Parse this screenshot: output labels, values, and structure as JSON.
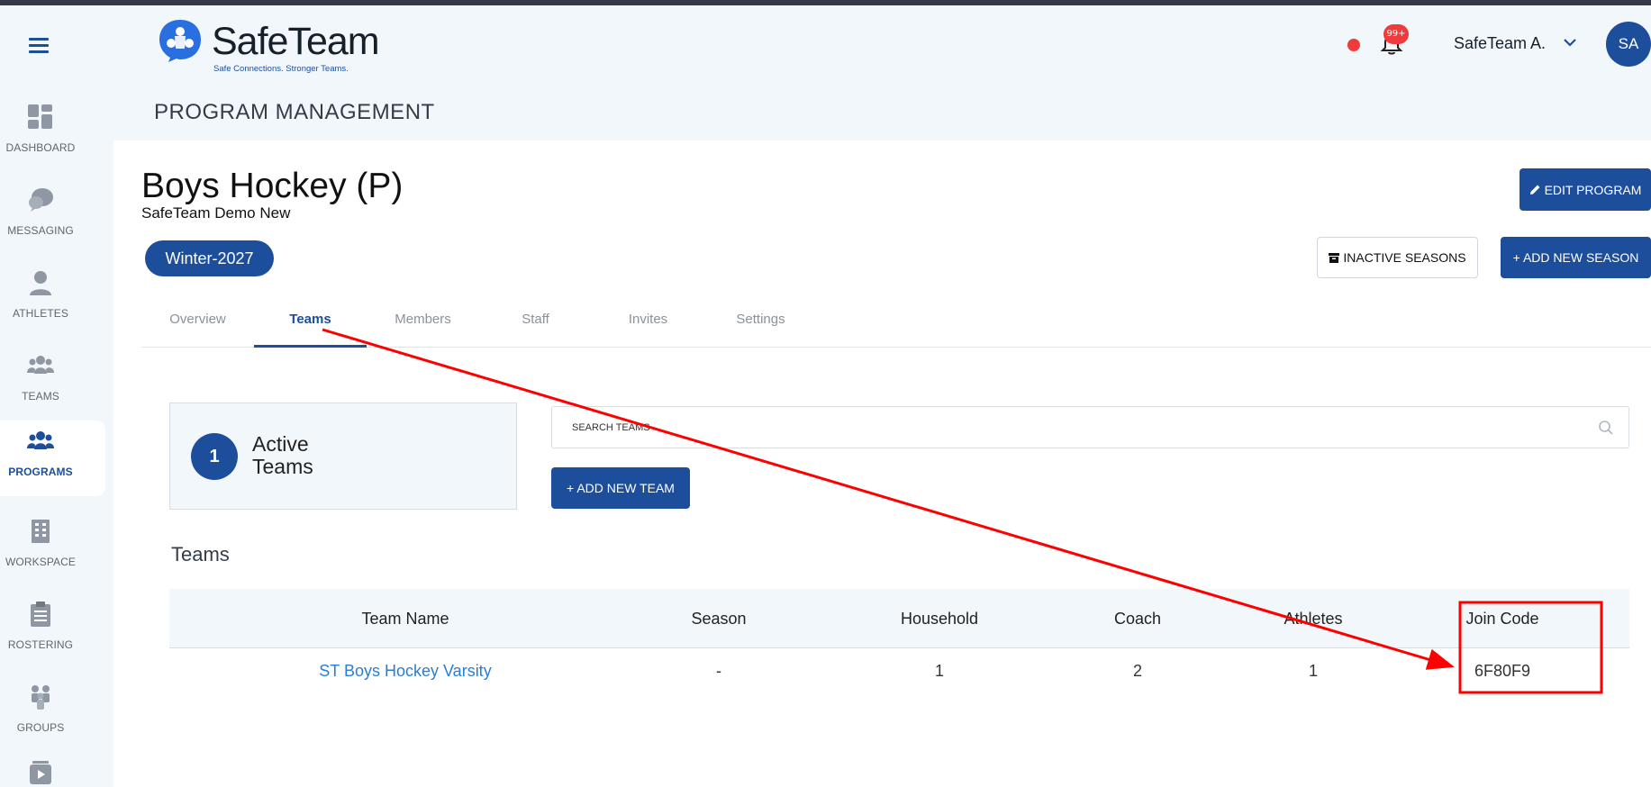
{
  "app": {
    "brand": "SafeTeam",
    "tagline": "Safe Connections. Stronger Teams.",
    "section_title": "PROGRAM MANAGEMENT"
  },
  "colors": {
    "primary": "#1d4e9b",
    "link": "#2a7dd6",
    "alert": "#ef3b3b",
    "annotation": "#ff0000"
  },
  "sidebar": {
    "menu_icon": "hamburger-icon",
    "items": [
      {
        "label": "DASHBOARD",
        "icon": "dashboard-icon",
        "active": false
      },
      {
        "label": "MESSAGING",
        "icon": "chat-bubbles-icon",
        "active": false
      },
      {
        "label": "ATHLETES",
        "icon": "person-icon",
        "active": false
      },
      {
        "label": "TEAMS",
        "icon": "group-icon",
        "active": false
      },
      {
        "label": "PROGRAMS",
        "icon": "group-icon",
        "active": true
      },
      {
        "label": "WORKSPACE",
        "icon": "building-icon",
        "active": false
      },
      {
        "label": "ROSTERING",
        "icon": "clipboard-icon",
        "active": false
      },
      {
        "label": "GROUPS",
        "icon": "people-icon",
        "active": false
      },
      {
        "label": "",
        "icon": "video-icon",
        "active": false
      }
    ]
  },
  "header": {
    "notification_badge": "99+",
    "user_name": "SafeTeam A.",
    "avatar_initials": "SA"
  },
  "program": {
    "title": "Boys Hockey (P)",
    "organization": "SafeTeam Demo New",
    "season": "Winter-2027",
    "edit_button": "EDIT PROGRAM",
    "inactive_seasons_button": "INACTIVE SEASONS",
    "add_season_button": "+ ADD NEW SEASON"
  },
  "tabs": [
    {
      "label": "Overview",
      "active": false
    },
    {
      "label": "Teams",
      "active": true
    },
    {
      "label": "Members",
      "active": false
    },
    {
      "label": "Staff",
      "active": false
    },
    {
      "label": "Invites",
      "active": false
    },
    {
      "label": "Settings",
      "active": false
    }
  ],
  "teams_panel": {
    "active_count": "1",
    "active_label": "Active Teams",
    "search_placeholder": "SEARCH TEAMS",
    "search_value": "",
    "add_team_button": "+ ADD NEW TEAM",
    "heading": "Teams"
  },
  "table": {
    "columns": [
      "Team Name",
      "Season",
      "Household",
      "Coach",
      "Athletes",
      "Join Code"
    ],
    "rows": [
      {
        "team_name": "ST Boys Hockey Varsity",
        "season": "-",
        "household": "1",
        "coach": "2",
        "athletes": "1",
        "join_code": "6F80F9"
      }
    ]
  }
}
